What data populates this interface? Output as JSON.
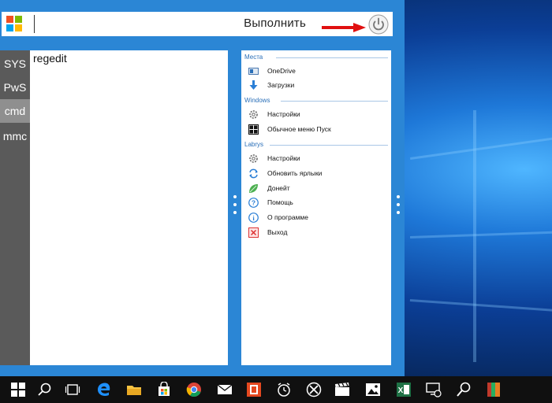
{
  "search": {
    "run_label": "Выполнить"
  },
  "sidebar": {
    "items": [
      {
        "label": "SYS"
      },
      {
        "label": "PwS"
      },
      {
        "label": "cmd"
      },
      {
        "label": "mmc"
      }
    ],
    "active": "cmd"
  },
  "editor": {
    "text": "regedit"
  },
  "links": {
    "sections": [
      {
        "title": "Места",
        "items": [
          {
            "label": "OneDrive",
            "icon": "onedrive-icon"
          },
          {
            "label": "Загрузки",
            "icon": "download-icon"
          }
        ]
      },
      {
        "title": "Windows",
        "items": [
          {
            "label": "Настройки",
            "icon": "gear-icon"
          },
          {
            "label": "Обычное меню Пуск",
            "icon": "start-menu-icon"
          }
        ]
      },
      {
        "title": "Labrys",
        "items": [
          {
            "label": "Настройки",
            "icon": "gear-icon"
          },
          {
            "label": "Обновить ярлыки",
            "icon": "refresh-shortcuts-icon"
          },
          {
            "label": "Донейт",
            "icon": "leaf-icon"
          },
          {
            "label": "Помощь",
            "icon": "help-icon"
          },
          {
            "label": "О программе",
            "icon": "info-icon"
          },
          {
            "label": "Выход",
            "icon": "exit-icon"
          }
        ]
      }
    ]
  },
  "taskbar": {
    "icons": [
      "start-icon",
      "search-icon",
      "task-view-icon",
      "edge-icon",
      "file-explorer-icon",
      "store-icon",
      "chrome-icon",
      "mail-icon",
      "office-icon",
      "alarms-icon",
      "xbox-icon",
      "movies-icon",
      "photos-icon",
      "excel-icon",
      "remote-desktop-icon",
      "search-tool-icon",
      "winrar-icon"
    ]
  },
  "colors": {
    "panel_blue": "#2b86d5",
    "sidebar_gray": "#5a5a5a",
    "active_gray": "#8f8f8f",
    "arrow_red": "#e01010",
    "section_blue": "#2a6fb8"
  }
}
